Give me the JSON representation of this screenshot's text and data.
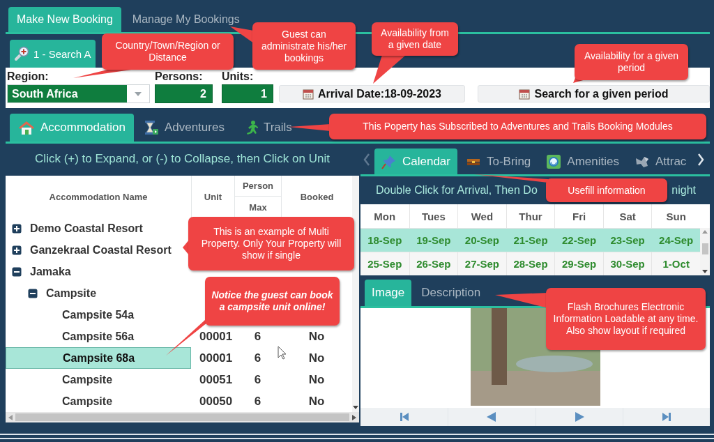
{
  "main_tabs": [
    {
      "label": "Make New Booking",
      "selected": true
    },
    {
      "label": "Manage My Bookings",
      "selected": false
    }
  ],
  "search_tab": {
    "label": "1 - Search A"
  },
  "search_form": {
    "region_label": "Region:",
    "region_value": "South Africa",
    "persons_label": "Persons:",
    "persons_value": "2",
    "units_label": "Units:",
    "units_value": "1",
    "arrival_button": "Arrival Date:18-09-2023",
    "period_button": "Search for a given period"
  },
  "module_tabs": [
    {
      "label": "Accommodation",
      "selected": true
    },
    {
      "label": "Adventures",
      "selected": false
    },
    {
      "label": "Trails",
      "selected": false
    }
  ],
  "tree": {
    "hint": "Click (+) to Expand, or (-) to Collapse, then Click on Unit",
    "columns": [
      {
        "label": "Accommodation Name"
      },
      {
        "label": "Unit"
      },
      {
        "label": "Person",
        "sublabel": "Max"
      },
      {
        "label": "Booked"
      }
    ],
    "rows": [
      {
        "name": "Demo Coastal Resort",
        "expanded": false,
        "selected": false
      },
      {
        "name": "Ganzekraal Coastal Resort",
        "expanded": false,
        "selected": false
      },
      {
        "name": "Jamaka",
        "expanded": true,
        "selected": false,
        "children": [
          {
            "name": "Campsite",
            "expanded": true,
            "selected": false,
            "children": [
              {
                "name": "Campsite 54a",
                "selected": false
              },
              {
                "name": "Campsite 56a",
                "unit": "00001",
                "max": "6",
                "booked": "No",
                "selected": false
              },
              {
                "name": "Campsite 68a",
                "unit": "00001",
                "max": "6",
                "booked": "No",
                "selected": true
              },
              {
                "name": "Campsite",
                "unit": "00051",
                "max": "6",
                "booked": "No",
                "selected": false
              },
              {
                "name": "Campsite",
                "unit": "00050",
                "max": "6",
                "booked": "No",
                "selected": false
              }
            ]
          }
        ]
      }
    ]
  },
  "calendar": {
    "tabs": [
      {
        "label": "Calendar",
        "selected": true
      },
      {
        "label": "To-Bring",
        "selected": false
      },
      {
        "label": "Amenities",
        "selected": false
      },
      {
        "label": "Attrac",
        "selected": false
      }
    ],
    "hint_start": "Double Click for Arrival, Then Do",
    "hint_end": "night",
    "days": [
      "Mon",
      "Tues",
      "Wed",
      "Thur",
      "Fri",
      "Sat",
      "Sun"
    ],
    "weeks": [
      {
        "selected": true,
        "dates": [
          "18-Sep",
          "19-Sep",
          "20-Sep",
          "21-Sep",
          "22-Sep",
          "23-Sep",
          "24-Sep"
        ]
      },
      {
        "selected": false,
        "dates": [
          "25-Sep",
          "26-Sep",
          "27-Sep",
          "28-Sep",
          "29-Sep",
          "30-Sep",
          "1-Oct"
        ]
      }
    ]
  },
  "brochure": {
    "tabs": [
      {
        "label": "Image",
        "selected": true
      },
      {
        "label": "Description",
        "selected": false
      }
    ]
  },
  "callouts": [
    {
      "kind": "note",
      "text": "Country/Town/Region or Distance"
    },
    {
      "kind": "note",
      "text": "Guest can administrate his/her bookings"
    },
    {
      "kind": "note",
      "text": "Availability from a given date"
    },
    {
      "kind": "note",
      "text": "Availability for a given period"
    },
    {
      "kind": "note",
      "text": "This Poperty has Subscribed to Adventures and Trails Booking Modules"
    },
    {
      "kind": "note",
      "text": "Usefill information"
    },
    {
      "kind": "note",
      "text": "This is an example of Multi Property. Only Your Property will show if single"
    },
    {
      "kind": "emphasis",
      "text": "Notice the guest can book a campsite unit online!"
    },
    {
      "kind": "note",
      "text": "Flash Brochures Electronic Information Loadable at any time. Also show layout if required"
    }
  ]
}
